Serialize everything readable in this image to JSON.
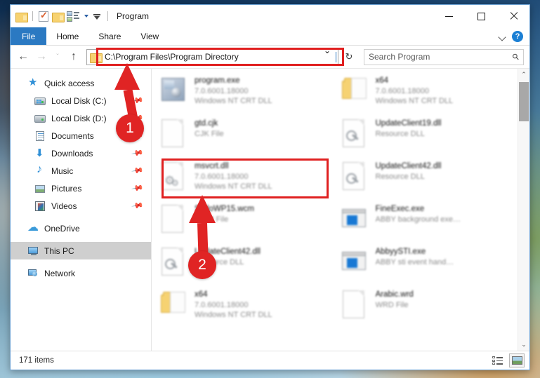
{
  "window": {
    "title": "Program",
    "quick_access_toolbar": [
      {
        "name": "folder-icon",
        "label": "Folder"
      },
      {
        "name": "properties-icon",
        "label": "Properties"
      },
      {
        "name": "new-folder-icon",
        "label": "New folder"
      },
      {
        "name": "view-options-icon",
        "label": "Customize Quick Access Toolbar"
      },
      {
        "name": "qat-dropdown-icon",
        "label": "Customize"
      }
    ],
    "controls": {
      "minimize": "Minimize",
      "maximize": "Maximize",
      "close": "Close"
    }
  },
  "ribbon": {
    "tabs": [
      {
        "label": "File",
        "active": true
      },
      {
        "label": "Home",
        "active": false
      },
      {
        "label": "Share",
        "active": false
      },
      {
        "label": "View",
        "active": false
      }
    ],
    "collapse_label": "Minimize the Ribbon",
    "help_label": "?"
  },
  "navigation": {
    "back_label": "←",
    "forward_label": "→",
    "recent_label": "ˇ",
    "up_label": "↑",
    "address_value": "C:\\Program Files\\Program Directory",
    "address_dropdown": "ˇ",
    "refresh_label": "↻"
  },
  "search": {
    "placeholder": "Search Program",
    "icon": "search-icon"
  },
  "sidebar": {
    "items": [
      {
        "label": "Quick access",
        "icon": "quick-access-star-icon",
        "child": false,
        "pinned": false,
        "selected": false
      },
      {
        "label": "Local Disk (C:)",
        "icon": "hard-drive-windows-icon",
        "child": true,
        "pinned": true,
        "selected": false
      },
      {
        "label": "Local Disk (D:)",
        "icon": "hard-drive-icon",
        "child": true,
        "pinned": true,
        "selected": false
      },
      {
        "label": "Documents",
        "icon": "documents-icon",
        "child": true,
        "pinned": true,
        "selected": false
      },
      {
        "label": "Downloads",
        "icon": "downloads-icon",
        "child": true,
        "pinned": true,
        "selected": false
      },
      {
        "label": "Music",
        "icon": "music-note-icon",
        "child": true,
        "pinned": true,
        "selected": false
      },
      {
        "label": "Pictures",
        "icon": "pictures-icon",
        "child": true,
        "pinned": true,
        "selected": false
      },
      {
        "label": "Videos",
        "icon": "videos-icon",
        "child": true,
        "pinned": true,
        "selected": false
      },
      {
        "label": "OneDrive",
        "icon": "onedrive-cloud-icon",
        "child": false,
        "pinned": false,
        "selected": false,
        "gap_before": true
      },
      {
        "label": "This PC",
        "icon": "this-pc-icon",
        "child": false,
        "pinned": false,
        "selected": true,
        "gap_before": true
      },
      {
        "label": "Network",
        "icon": "network-icon",
        "child": false,
        "pinned": false,
        "selected": false,
        "gap_before": true
      }
    ]
  },
  "files": [
    {
      "name": "program.exe",
      "version": "7.0.6001.18000",
      "desc": "Windows NT CRT DLL",
      "icon": "exe-icon",
      "highlighted": false
    },
    {
      "name": "x64",
      "version": "7.0.6001.18000",
      "desc": "Windows NT CRT DLL",
      "icon": "folder-icon",
      "highlighted": false
    },
    {
      "name": "gtd.cjk",
      "version": "",
      "desc": "CJK File",
      "icon": "blank-page-icon",
      "highlighted": false
    },
    {
      "name": "UpdateClient19.dll",
      "version": "",
      "desc": "Resource DLL",
      "icon": "resource-dll-icon",
      "highlighted": false
    },
    {
      "name": "msvcrt.dll",
      "version": "7.0.6001.18000",
      "desc": "Windows NT CRT DLL",
      "icon": "dll-gear-icon",
      "highlighted": true
    },
    {
      "name": "UpdateClient42.dll",
      "version": "",
      "desc": "Resource DLL",
      "icon": "resource-dll-icon",
      "highlighted": false
    },
    {
      "name": "SpdoWP15.wcm",
      "version": "",
      "desc": "WCM File",
      "icon": "blank-page-icon",
      "highlighted": false
    },
    {
      "name": "FineExec.exe",
      "version": "",
      "desc": "ABBY background exe…",
      "icon": "app-window-icon",
      "highlighted": false
    },
    {
      "name": "UpdateClient42.dll",
      "version": "",
      "desc": "Resource DLL",
      "icon": "resource-dll-icon",
      "highlighted": false
    },
    {
      "name": "AbbyySTI.exe",
      "version": "",
      "desc": "ABBY sti event hand…",
      "icon": "app-window-icon",
      "highlighted": false
    },
    {
      "name": "x64",
      "version": "7.0.6001.18000",
      "desc": "Windows NT CRT DLL",
      "icon": "folder-icon",
      "highlighted": false
    },
    {
      "name": "Arabic.wrd",
      "version": "",
      "desc": "WRD File",
      "icon": "blank-page-icon",
      "highlighted": false
    }
  ],
  "scrollbar": {
    "up_arrow": "⌃",
    "down_arrow": "⌄"
  },
  "statusbar": {
    "item_count": "171 items",
    "views": [
      {
        "name": "details-view-button",
        "label": "Details view",
        "active": false
      },
      {
        "name": "large-icons-view-button",
        "label": "Large icons view",
        "active": true
      }
    ]
  },
  "annotations": {
    "markers": [
      {
        "number": "1",
        "target": "address-bar"
      },
      {
        "number": "2",
        "target": "msvcrt-dll-file-item"
      }
    ],
    "accent_color": "#e02424"
  }
}
